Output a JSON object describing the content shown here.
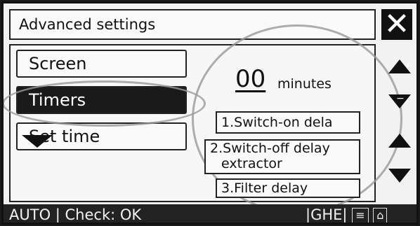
{
  "window": {
    "title": "Advanced settings",
    "close_label": "✕"
  },
  "menu": {
    "items": [
      {
        "label": "Screen",
        "selected": false
      },
      {
        "label": "Timers",
        "selected": true
      },
      {
        "label": "Set time",
        "selected": false
      }
    ]
  },
  "timer": {
    "value": "00",
    "unit": "minutes",
    "options": [
      {
        "label": "1.Switch-on dela"
      },
      {
        "label": "2.Switch-off delay",
        "label2": "extractor"
      },
      {
        "label": "3.Filter delay"
      }
    ]
  },
  "controls": {
    "plus_symbol": "+",
    "minus_symbol": "−"
  },
  "status": {
    "left_text": "AUTO | Check: OK",
    "right_code": "GHE"
  },
  "colors": {
    "screen_bg": "#f2f2f2",
    "dark": "#111111",
    "highlight_ring": "#999999"
  }
}
